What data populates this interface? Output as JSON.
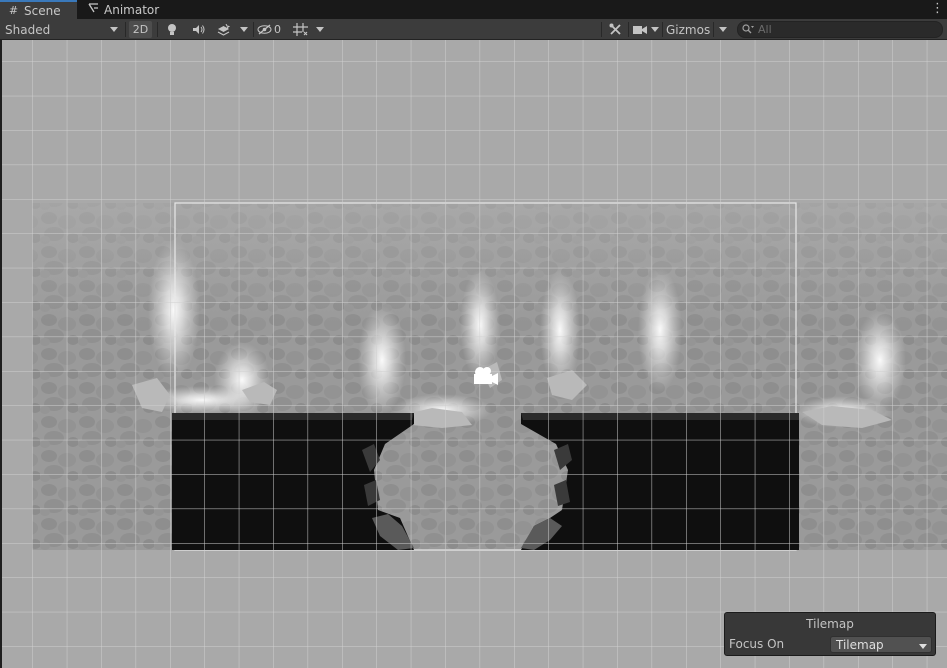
{
  "tabs": [
    {
      "label": "Scene",
      "icon": "grid-icon",
      "active": true
    },
    {
      "label": "Animator",
      "icon": "animator-icon",
      "active": false
    }
  ],
  "toolbar": {
    "shading_mode": "Shaded",
    "mode_2d_label": "2D",
    "hidden_count": "0",
    "gizmos_label": "Gizmos",
    "search_placeholder": "All"
  },
  "overlay": {
    "title": "Tilemap",
    "focus_label": "Focus On",
    "focus_value": "Tilemap"
  },
  "colors": {
    "viewport_bg": "#a9a9a9",
    "grid_line": "#d0d0d0",
    "tab_accent": "#3a79bb",
    "platform": "#0f0f0f"
  }
}
